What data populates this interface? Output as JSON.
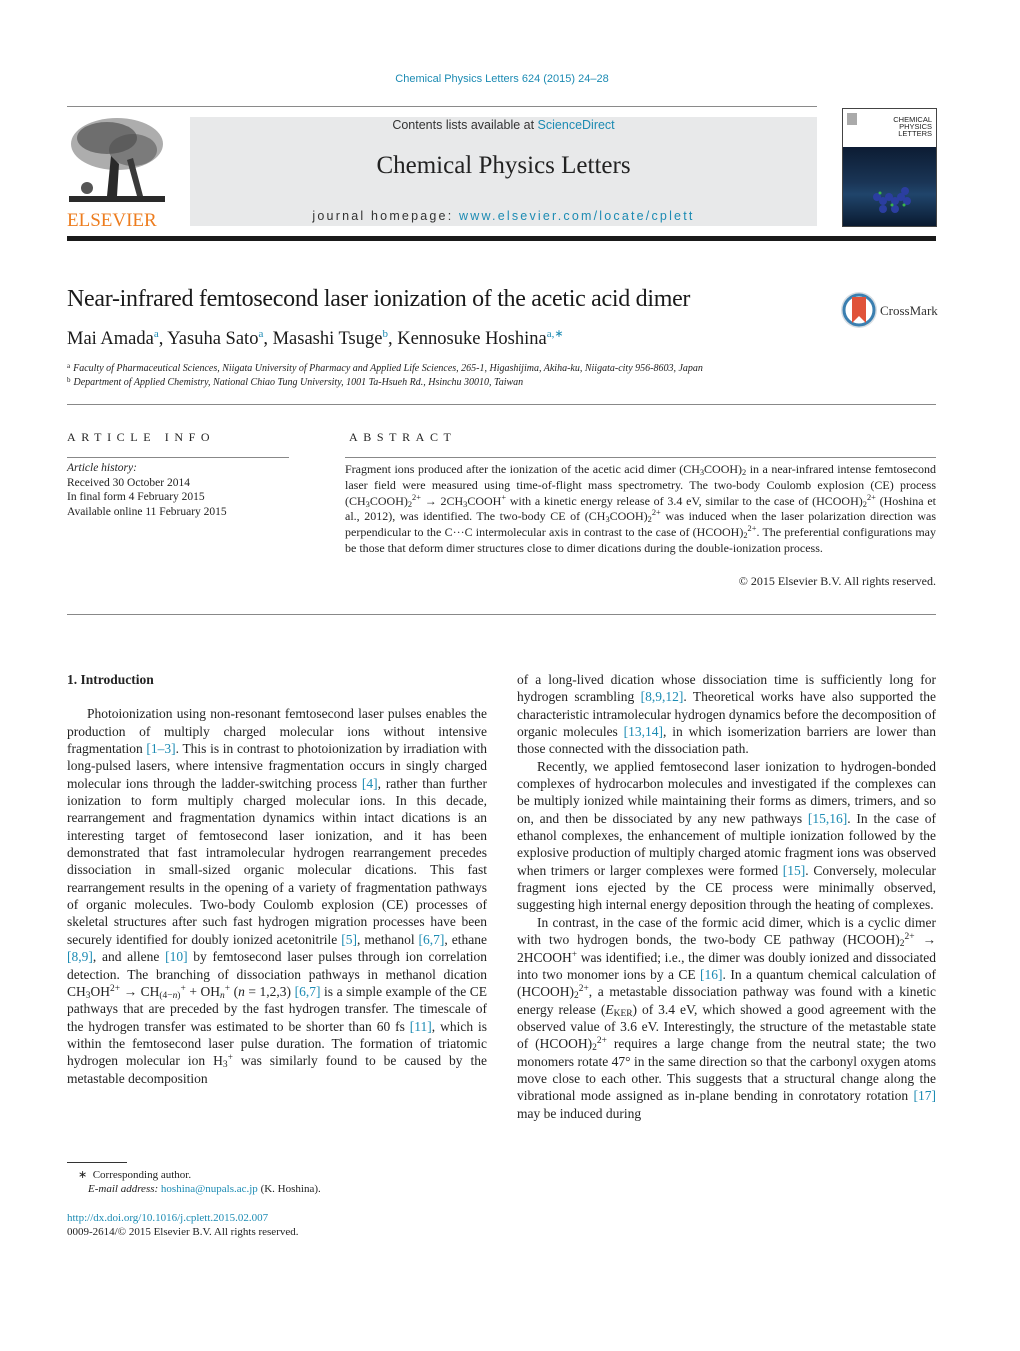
{
  "header": {
    "journal_ref": "Chemical Physics Letters 624 (2015) 24–28",
    "contents_prefix": "Contents lists available at ",
    "contents_link": "ScienceDirect",
    "journal_title": "Chemical Physics Letters",
    "homepage_prefix": "journal homepage: ",
    "homepage_link": "www.elsevier.com/locate/cplett",
    "publisher_logo": "ELSEVIER",
    "cover_title_lines": [
      "CHEMICAL",
      "PHYSICS",
      "LETTERS"
    ],
    "crossmark_label": "CrossMark",
    "colors": {
      "link": "#1c8bb3",
      "elsevier_orange": "#ed7d1f",
      "masthead_bg": "#e8e9ea"
    }
  },
  "article": {
    "title": "Near-infrared femtosecond laser ionization of the acetic acid dimer",
    "authors": [
      {
        "name": "Mai Amada",
        "aff": "a"
      },
      {
        "name": "Yasuha Sato",
        "aff": "a"
      },
      {
        "name": "Masashi Tsuge",
        "aff": "b"
      },
      {
        "name": "Kennosuke Hoshina",
        "aff": "a,∗"
      }
    ],
    "affiliations": [
      {
        "mark": "a",
        "text": "Faculty of Pharmaceutical Sciences, Niigata University of Pharmacy and Applied Life Sciences, 265-1, Higashijima, Akiha-ku, Niigata-city 956-8603, Japan"
      },
      {
        "mark": "b",
        "text": "Department of Applied Chemistry, National Chiao Tung University, 1001 Ta-Hsueh Rd., Hsinchu 30010, Taiwan"
      }
    ]
  },
  "article_info": {
    "heading": "ARTICLE INFO",
    "history_label": "Article history:",
    "received": "Received 30 October 2014",
    "final_form": "In final form 4 February 2015",
    "online": "Available online 11 February 2015"
  },
  "abstract": {
    "heading": "ABSTRACT",
    "copyright": "© 2015 Elsevier B.V. All rights reserved."
  },
  "intro": {
    "heading": "1.  Introduction",
    "refs": {
      "r1_3": "[1–3]",
      "r4": "[4]",
      "r5": "[5]",
      "r6_7": "[6,7]",
      "r8_9": "[8,9]",
      "r10": "[10]",
      "r11": "[11]",
      "r8_9_12": "[8,9,12]",
      "r13_14": "[13,14]",
      "r15_16": "[15,16]",
      "r15": "[15]",
      "r16": "[16]",
      "r17": "[17]"
    }
  },
  "footnote": {
    "star": "∗",
    "corresponding": "Corresponding author.",
    "email_label": "E-mail address: ",
    "email": "hoshina@nupals.ac.jp",
    "email_suffix": " (K. Hoshina).",
    "doi": "http://dx.doi.org/10.1016/j.cplett.2015.02.007",
    "issn_line": "0009-2614/© 2015 Elsevier B.V. All rights reserved."
  }
}
